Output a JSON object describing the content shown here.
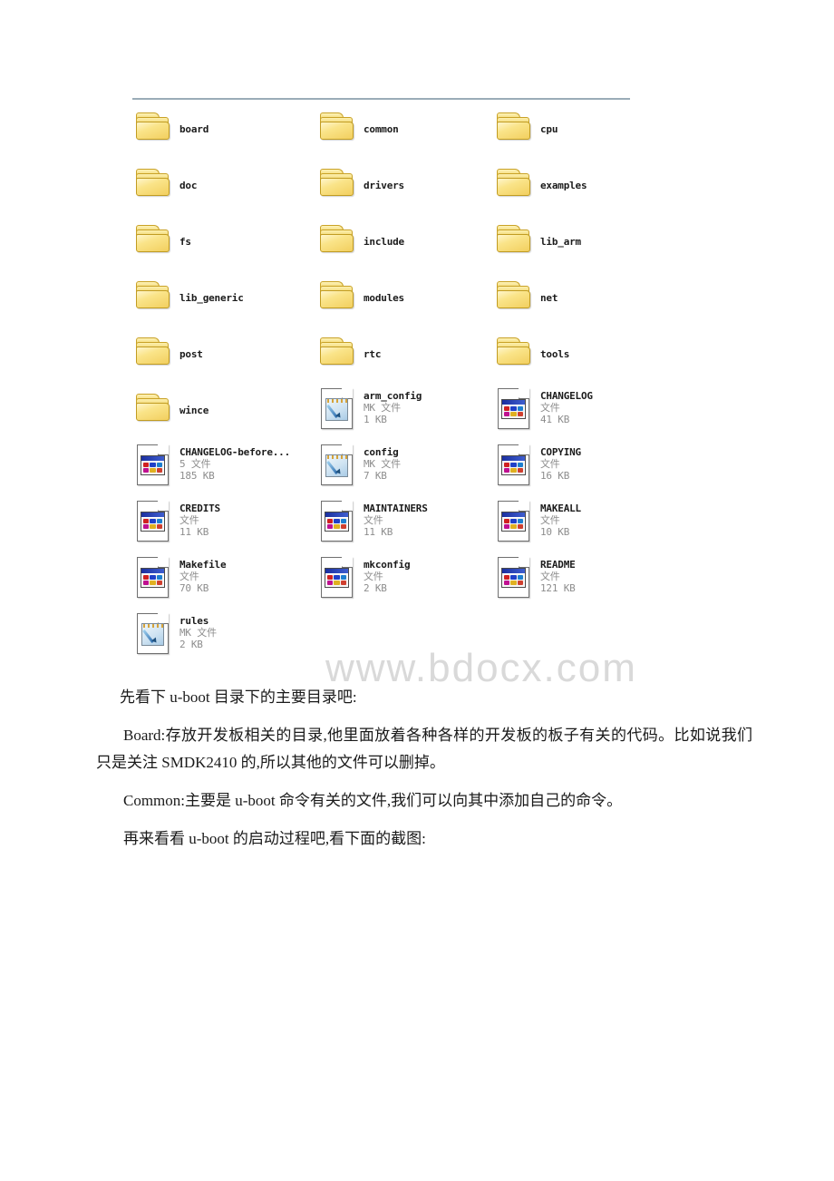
{
  "document": {
    "background": "#ffffff",
    "watermark": "www.bdocx.com",
    "watermark_color": "#d9d9d9"
  },
  "explorer": {
    "top_rule_color": "#9aacb8",
    "icons": {
      "folder": "folder-icon",
      "file": "generic-file-icon",
      "mk": "mk-file-icon"
    },
    "items": [
      {
        "name": "board",
        "type": "",
        "size": "",
        "icon": "folder",
        "col": 0,
        "row": 0
      },
      {
        "name": "common",
        "type": "",
        "size": "",
        "icon": "folder",
        "col": 1,
        "row": 0
      },
      {
        "name": "cpu",
        "type": "",
        "size": "",
        "icon": "folder",
        "col": 2,
        "row": 0
      },
      {
        "name": "doc",
        "type": "",
        "size": "",
        "icon": "folder",
        "col": 0,
        "row": 1
      },
      {
        "name": "drivers",
        "type": "",
        "size": "",
        "icon": "folder",
        "col": 1,
        "row": 1
      },
      {
        "name": "examples",
        "type": "",
        "size": "",
        "icon": "folder",
        "col": 2,
        "row": 1
      },
      {
        "name": "fs",
        "type": "",
        "size": "",
        "icon": "folder",
        "col": 0,
        "row": 2
      },
      {
        "name": "include",
        "type": "",
        "size": "",
        "icon": "folder",
        "col": 1,
        "row": 2
      },
      {
        "name": "lib_arm",
        "type": "",
        "size": "",
        "icon": "folder",
        "col": 2,
        "row": 2
      },
      {
        "name": "lib_generic",
        "type": "",
        "size": "",
        "icon": "folder",
        "col": 0,
        "row": 3
      },
      {
        "name": "modules",
        "type": "",
        "size": "",
        "icon": "folder",
        "col": 1,
        "row": 3
      },
      {
        "name": "net",
        "type": "",
        "size": "",
        "icon": "folder",
        "col": 2,
        "row": 3
      },
      {
        "name": "post",
        "type": "",
        "size": "",
        "icon": "folder",
        "col": 0,
        "row": 4
      },
      {
        "name": "rtc",
        "type": "",
        "size": "",
        "icon": "folder",
        "col": 1,
        "row": 4
      },
      {
        "name": "tools",
        "type": "",
        "size": "",
        "icon": "folder",
        "col": 2,
        "row": 4
      },
      {
        "name": "wince",
        "type": "",
        "size": "",
        "icon": "folder",
        "col": 0,
        "row": 5
      },
      {
        "name": "arm_config",
        "type": "MK 文件",
        "size": "1 KB",
        "icon": "mk",
        "col": 1,
        "row": 5
      },
      {
        "name": "CHANGELOG",
        "type": "文件",
        "size": "41 KB",
        "icon": "file",
        "col": 2,
        "row": 5
      },
      {
        "name": "CHANGELOG-before...",
        "type": "5 文件",
        "size": "185 KB",
        "icon": "file",
        "col": 0,
        "row": 6
      },
      {
        "name": "config",
        "type": "MK 文件",
        "size": "7 KB",
        "icon": "mk",
        "col": 1,
        "row": 6
      },
      {
        "name": "COPYING",
        "type": "文件",
        "size": "16 KB",
        "icon": "file",
        "col": 2,
        "row": 6
      },
      {
        "name": "CREDITS",
        "type": "文件",
        "size": "11 KB",
        "icon": "file",
        "col": 0,
        "row": 7
      },
      {
        "name": "MAINTAINERS",
        "type": "文件",
        "size": "11 KB",
        "icon": "file",
        "col": 1,
        "row": 7
      },
      {
        "name": "MAKEALL",
        "type": "文件",
        "size": "10 KB",
        "icon": "file",
        "col": 2,
        "row": 7
      },
      {
        "name": "Makefile",
        "type": "文件",
        "size": "70 KB",
        "icon": "file",
        "col": 0,
        "row": 8
      },
      {
        "name": "mkconfig",
        "type": "文件",
        "size": "2 KB",
        "icon": "file",
        "col": 1,
        "row": 8
      },
      {
        "name": "README",
        "type": "文件",
        "size": "121 KB",
        "icon": "file",
        "col": 2,
        "row": 8
      },
      {
        "name": "rules",
        "type": "MK 文件",
        "size": "2 KB",
        "icon": "mk",
        "col": 0,
        "row": 9
      }
    ]
  },
  "prose": {
    "paragraphs": [
      "先看下 u-boot 目录下的主要目录吧:",
      "Board:存放开发板相关的目录,他里面放着各种各样的开发板的板子有关的代码。比如说我们只是关注 SMDK2410 的,所以其他的文件可以删掉。",
      "Common:主要是 u-boot 命令有关的文件,我们可以向其中添加自己的命令。",
      "再来看看 u-boot 的启动过程吧,看下面的截图:"
    ]
  }
}
